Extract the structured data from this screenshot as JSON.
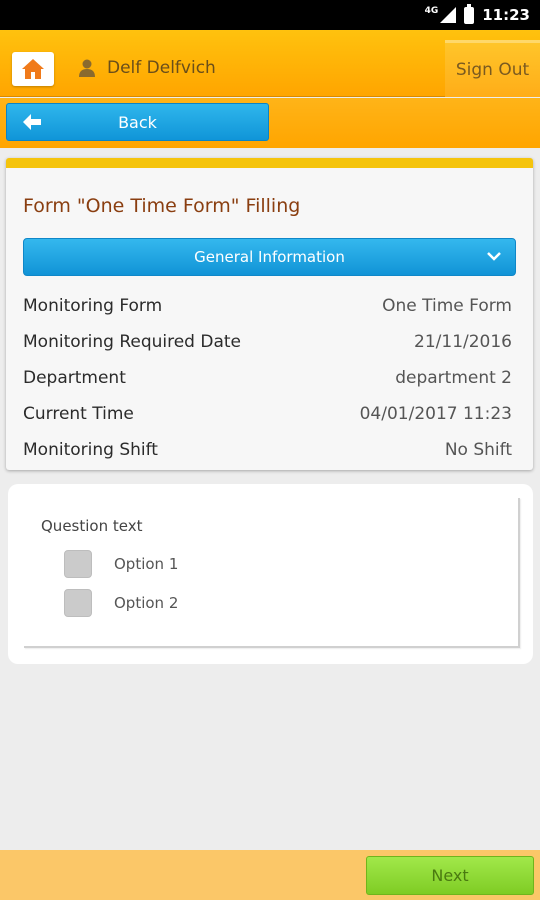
{
  "status_bar": {
    "network": "4G",
    "time": "11:23"
  },
  "header": {
    "home_icon": "home-icon",
    "user_icon": "person-icon",
    "user_name": "Delf Delfvich",
    "signout_label": "Sign Out"
  },
  "nav": {
    "back_label": "Back",
    "back_icon": "arrow-left-icon"
  },
  "form": {
    "title": "Form \"One Time Form\" Filling",
    "section_label": "General Information",
    "rows": [
      {
        "label": "Monitoring Form",
        "value": "One Time Form"
      },
      {
        "label": "Monitoring Required Date",
        "value": "21/11/2016"
      },
      {
        "label": "Department",
        "value": "department 2"
      },
      {
        "label": "Current Time",
        "value": "04/01/2017 11:23"
      },
      {
        "label": "Monitoring Shift",
        "value": "No Shift"
      }
    ]
  },
  "question": {
    "text": "Question text",
    "options": [
      {
        "label": "Option 1",
        "checked": false
      },
      {
        "label": "Option 2",
        "checked": false
      }
    ]
  },
  "footer": {
    "next_label": "Next"
  },
  "colors": {
    "header": "#ffa500",
    "accent_blue": "#1095d8",
    "title": "#8a3e10",
    "next_button": "#7fcc24",
    "card_top": "#f5c40c"
  }
}
